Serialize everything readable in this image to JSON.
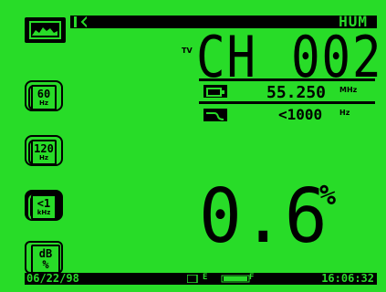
{
  "colors": {
    "lcd": "#28dc28",
    "ink": "#000000"
  },
  "header": {
    "mode_label": "HUM"
  },
  "icons": {
    "mode": "spectrum-mode-icon",
    "top_marker": "diamond-icon",
    "display": "display-icon",
    "filter": "filter-curve-icon",
    "battery": "battery-gauge-icon"
  },
  "left_buttons": [
    {
      "line1": "60",
      "line2": "Hz"
    },
    {
      "line1": "120",
      "line2": "Hz"
    },
    {
      "line1": "<1",
      "line2": "kHz"
    },
    {
      "line1": "dB",
      "line2": "%"
    }
  ],
  "channel": {
    "prefix": "TV",
    "label": "CH",
    "number": "002"
  },
  "frequency": {
    "value": "55.250",
    "unit": "MHz"
  },
  "bandwidth": {
    "value": "<1000",
    "unit": "Hz"
  },
  "reading": {
    "value": "0.6",
    "unit": "%"
  },
  "status": {
    "date": "06/22/98",
    "battery_empty": "E",
    "battery_full": "F",
    "time": "16:06:32"
  }
}
